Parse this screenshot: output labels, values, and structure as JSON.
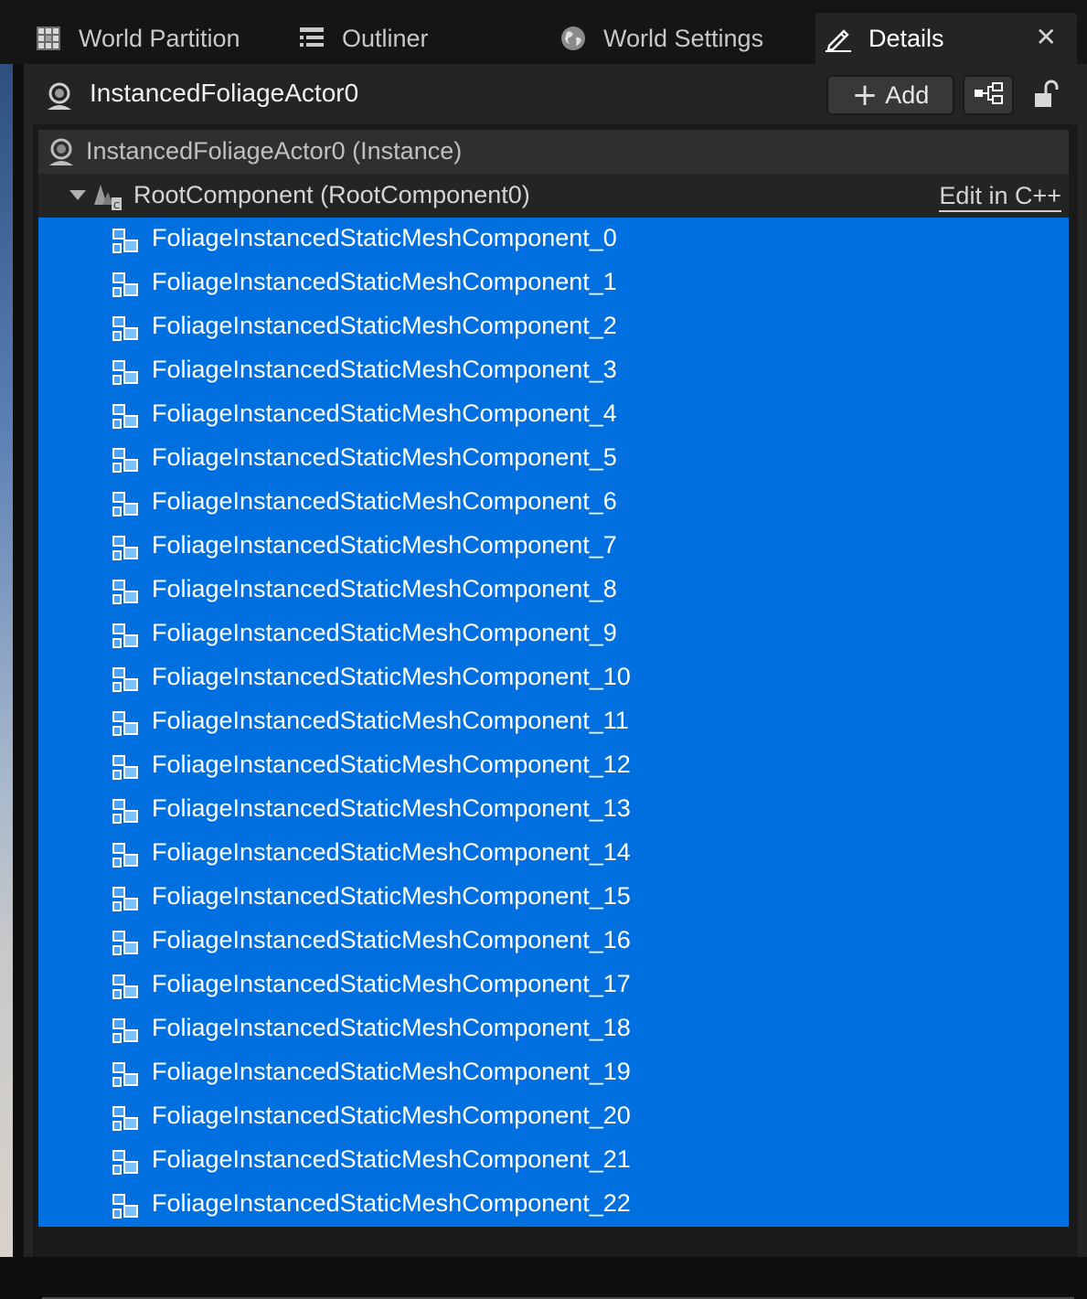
{
  "tabs": [
    {
      "label": "World Partition",
      "icon": "grid-icon",
      "active": false
    },
    {
      "label": "Outliner",
      "icon": "list-icon",
      "active": false
    },
    {
      "label": "World Settings",
      "icon": "globe-icon",
      "active": false
    },
    {
      "label": "Details",
      "icon": "pencil-icon",
      "active": true
    }
  ],
  "close_glyph": "✕",
  "header": {
    "actor_name": "InstancedFoliageActor0",
    "add_label": "Add"
  },
  "tree": {
    "instance_label": "InstancedFoliageActor0 (Instance)",
    "root_label": "RootComponent (RootComponent0)",
    "edit_link": "Edit in C++",
    "components": [
      "FoliageInstancedStaticMeshComponent_0",
      "FoliageInstancedStaticMeshComponent_1",
      "FoliageInstancedStaticMeshComponent_2",
      "FoliageInstancedStaticMeshComponent_3",
      "FoliageInstancedStaticMeshComponent_4",
      "FoliageInstancedStaticMeshComponent_5",
      "FoliageInstancedStaticMeshComponent_6",
      "FoliageInstancedStaticMeshComponent_7",
      "FoliageInstancedStaticMeshComponent_8",
      "FoliageInstancedStaticMeshComponent_9",
      "FoliageInstancedStaticMeshComponent_10",
      "FoliageInstancedStaticMeshComponent_11",
      "FoliageInstancedStaticMeshComponent_12",
      "FoliageInstancedStaticMeshComponent_13",
      "FoliageInstancedStaticMeshComponent_14",
      "FoliageInstancedStaticMeshComponent_15",
      "FoliageInstancedStaticMeshComponent_16",
      "FoliageInstancedStaticMeshComponent_17",
      "FoliageInstancedStaticMeshComponent_18",
      "FoliageInstancedStaticMeshComponent_19",
      "FoliageInstancedStaticMeshComponent_20",
      "FoliageInstancedStaticMeshComponent_21",
      "FoliageInstancedStaticMeshComponent_22"
    ]
  },
  "colors": {
    "selection": "#0070e0",
    "panel_bg": "#242424",
    "tab_bar_bg": "#151515"
  }
}
